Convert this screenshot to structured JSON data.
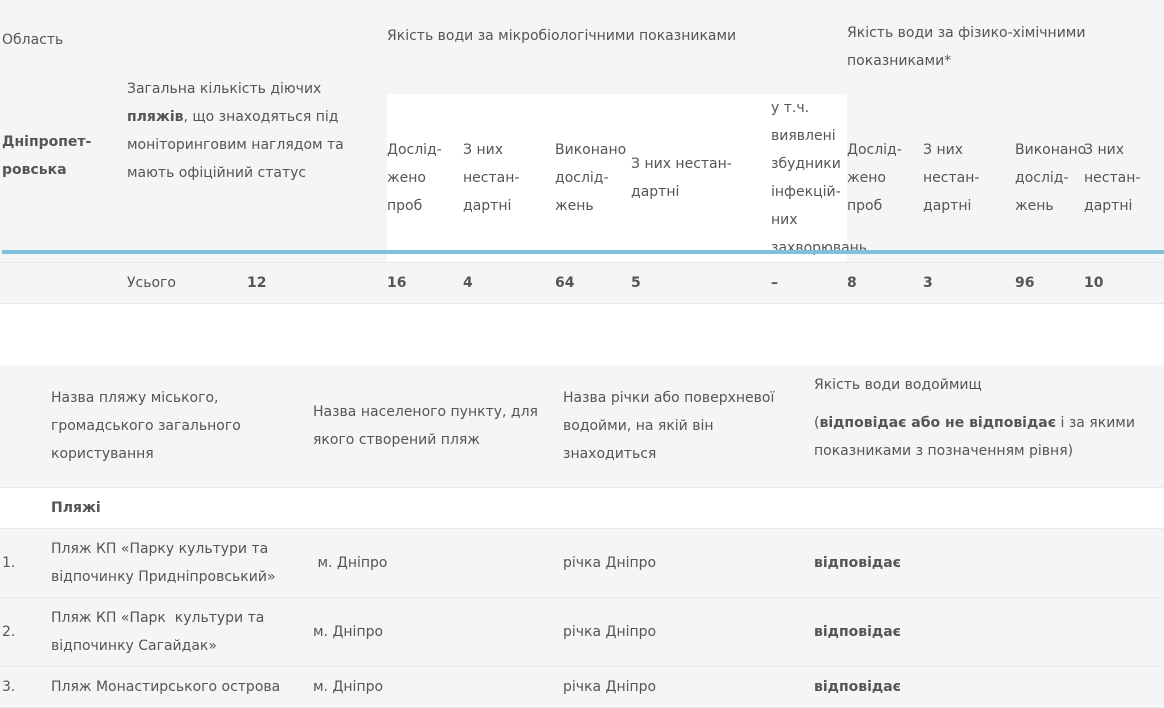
{
  "top_table": {
    "header": {
      "region_label": "Область",
      "total_beaches_prefix": "Загальна кількість діючих ",
      "total_beaches_bold": "пляжів",
      "total_beaches_suffix": ", що знаходяться під моніторинговим наглядом та мають офіційний статус",
      "micro_group": "Якість води за мікробіологічними показниками",
      "phys_group": "Якість води за фізико-хімічними показниками*",
      "micro_cols": [
        "Дослід-жено проб",
        "З них нестан-дартні",
        "Виконано дослід-жень",
        "З них нестан-дартні",
        "у т.ч. виявлені  збудники інфекцій-них захворювань"
      ],
      "phys_cols": [
        "Дослід-жено проб",
        "З них нестан-дартні",
        "Виконано дослід-жень",
        "З них нестан-дартні"
      ]
    },
    "region_value": "Дніпропет-ровська",
    "total_row": {
      "label": "Усього",
      "beaches": "12",
      "micro": [
        "16",
        "4",
        "64",
        "5",
        "–"
      ],
      "phys": [
        "8",
        "3",
        "96",
        "10"
      ]
    }
  },
  "beach_table": {
    "headers": {
      "name": "Назва пляжу міського, громадського загального користування",
      "settlement": "Назва населеного пункту, для якого створений пляж",
      "river": "Назва річки або поверхневої водойми, на якій він знаходиться",
      "quality_title": "Якість води водоймищ",
      "quality_open": "(",
      "quality_bold": "відповідає або не відповідає",
      "quality_rest": " і за якими показниками з позначенням рівня)"
    },
    "section_label": "Пляжі",
    "rows": [
      {
        "num": "1.",
        "name": "Пляж КП «Парку культури та відпочинку Придніпровський»",
        "settlement": " м. Дніпро",
        "river": "річка Дніпро",
        "quality": "відповідає"
      },
      {
        "num": "2.",
        "name": "Пляж КП «Парк  культури та відпочинку Сагайдак»",
        "settlement": "м. Дніпро",
        "river": "річка Дніпро",
        "quality": "відповідає"
      },
      {
        "num": "3.",
        "name": "Пляж Монастирського острова",
        "settlement": "м. Дніпро",
        "river": "річка Дніпро",
        "quality": "відповідає"
      }
    ]
  }
}
